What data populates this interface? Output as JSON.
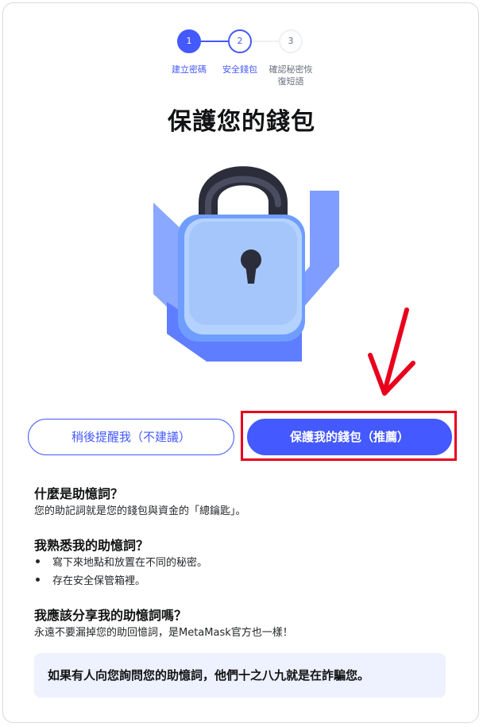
{
  "stepper": {
    "steps": [
      {
        "number": "1",
        "label": "建立密碼"
      },
      {
        "number": "2",
        "label": "安全錢包"
      },
      {
        "number": "3",
        "label_line1": "確認秘密恢",
        "label_line2": "復短語"
      }
    ],
    "active_color": "#4459ff"
  },
  "title": "保護您的錢包",
  "buttons": {
    "later": "稍後提醒我（不建議）",
    "secure": "保護我的錢包（推薦）"
  },
  "faq": {
    "q1": "什麼是助憶詞？",
    "a1": "您的助記詞就是您的錢包與資金的「總鑰匙」。",
    "q2": "我熟悉我的助憶詞？",
    "a2_items": [
      "寫下來地點和放置在不同的秘密。",
      "存在安全保管箱裡。"
    ],
    "q3": "我應該分享我的助憶詞嗎？",
    "a3": "永遠不要漏掉您的助回憶詞，是MetaMask官方也一樣！"
  },
  "warning": "如果有人向您詢問您的助憶詞，他們十之八九就是在詐騙您。",
  "colors": {
    "primary": "#4459ff",
    "annotation_red": "#e8001c",
    "warning_bg": "#eef1fe"
  },
  "icons": {
    "illustration": "padlock-icon",
    "annotation": "red-arrow-down-icon"
  }
}
